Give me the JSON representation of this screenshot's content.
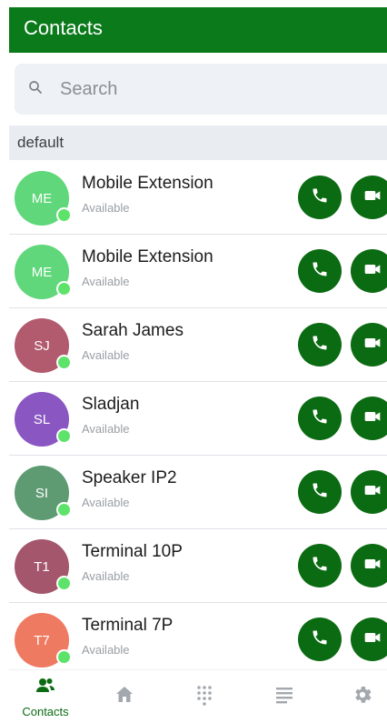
{
  "colors": {
    "green": "#0a7a1a",
    "button_green": "#0b6b12",
    "online": "#5ee36a"
  },
  "header": {
    "title": "Contacts"
  },
  "search": {
    "placeholder": "Search",
    "icon": "search-icon"
  },
  "section": {
    "label": "default"
  },
  "contacts": [
    {
      "initials": "ME",
      "name": "Mobile Extension",
      "status": "Available",
      "color": "#5fd77a"
    },
    {
      "initials": "ME",
      "name": "Mobile Extension",
      "status": "Available",
      "color": "#5fd77a"
    },
    {
      "initials": "SJ",
      "name": "Sarah James",
      "status": "Available",
      "color": "#b25a6e"
    },
    {
      "initials": "SL",
      "name": "Sladjan",
      "status": "Available",
      "color": "#8a57c2"
    },
    {
      "initials": "SI",
      "name": "Speaker IP2",
      "status": "Available",
      "color": "#5e9b72"
    },
    {
      "initials": "T1",
      "name": "Terminal 10P",
      "status": "Available",
      "color": "#a4566c"
    },
    {
      "initials": "T7",
      "name": "Terminal 7P",
      "status": "Available",
      "color": "#ef7a62"
    }
  ],
  "bottom_nav": {
    "contacts_label": "Contacts",
    "items": [
      "contacts-icon",
      "home-icon",
      "dialpad-icon",
      "list-icon",
      "settings-icon"
    ]
  }
}
